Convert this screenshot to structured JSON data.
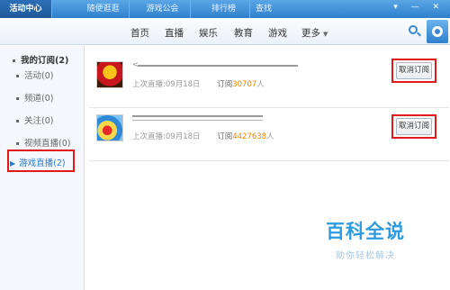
{
  "top_tabs": [
    "活动中心",
    "随便逛逛",
    "游戏公会",
    "排行榜",
    "查找"
  ],
  "window_buttons": "▾ — ✕",
  "nav": {
    "items": [
      "首页",
      "直播",
      "娱乐",
      "教育",
      "游戏"
    ],
    "more_label": "更多",
    "search_icon": "search-icon",
    "shield_icon": "shield-icon"
  },
  "sidebar": {
    "title": "我的订阅(2)",
    "items": [
      {
        "label": "活动(0)",
        "active": false
      },
      {
        "label": "频道(0)",
        "active": false
      },
      {
        "label": "关注(0)",
        "active": false
      },
      {
        "label": "视频直播(0)",
        "active": false
      },
      {
        "label": "游戏直播(2)",
        "active": true
      }
    ]
  },
  "subscriptions": [
    {
      "name_prefix": "<",
      "last_live_label": "上次直播:",
      "last_live_date": "09月18日",
      "subs_label": "订阅",
      "subs_count": "30707",
      "subs_unit": "人",
      "unsubscribe_label": "取消订阅"
    },
    {
      "name_prefix": "",
      "last_live_label": "上次直播:",
      "last_live_date": "09月18日",
      "subs_label": "订阅",
      "subs_count": "4427638",
      "subs_unit": "人",
      "unsubscribe_label": "取消订阅"
    }
  ],
  "watermark": {
    "title": "百科全说",
    "subtitle": "助你轻松解决"
  },
  "colors": {
    "accent_blue": "#2f7fcc",
    "highlight_red": "#e0191b",
    "count_orange": "#f08300"
  }
}
